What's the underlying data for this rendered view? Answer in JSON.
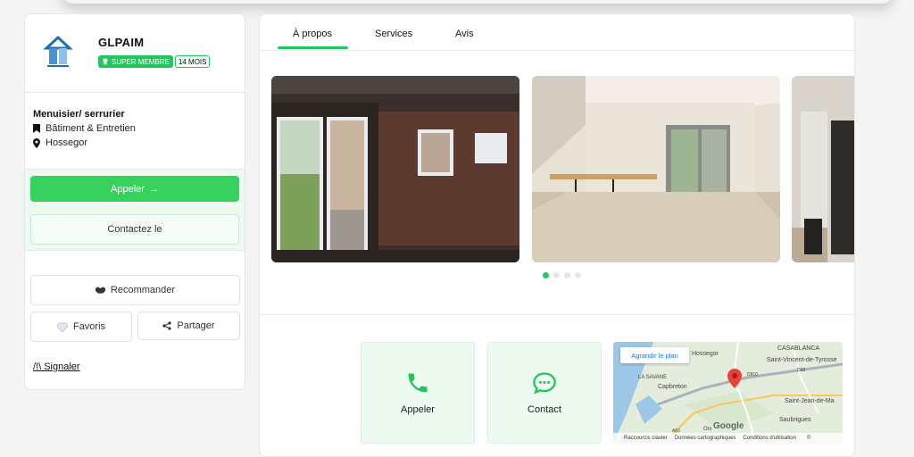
{
  "company": {
    "name": "GLPAIM",
    "badge_super": "SUPER MEMBRE",
    "badge_months": "14 MOIS"
  },
  "profile": {
    "profession": "Menuisier/ serrurier",
    "category": "Bâtiment & Entretien",
    "location": "Hossegor"
  },
  "actions": {
    "call_label": "Appeler",
    "call_arrow": "→",
    "contact_label": "Contactez le",
    "recommend_label": "Recommander",
    "favorites_label": "Favoris",
    "share_label": "Partager",
    "report_label": "/!\\ Signaler"
  },
  "tabs": [
    {
      "label": "À propos",
      "active": true
    },
    {
      "label": "Services",
      "active": false
    },
    {
      "label": "Avis",
      "active": false
    }
  ],
  "gallery": {
    "slide_count": 4,
    "active_index": 0
  },
  "contact_cards": {
    "call_label": "Appeler",
    "contact_label": "Contact"
  },
  "map": {
    "enlarge_label": "Agrandir le plan",
    "places": {
      "hossegor": "Hossegor",
      "casablanca": "CASABLANCA",
      "st_vincent": "Saint-Vincent-de-Tyrosse",
      "la_savane": "LA SAVANE",
      "capbreton": "Capbreton",
      "st_jean": "Saint-Jean-de-Ma",
      "saubrigues": "Saubrigues",
      "road_d810": "D810",
      "road_d33": "D33",
      "road_a63": "A63",
      "town_orx": "Orx"
    },
    "google": "Google",
    "footer": {
      "shortcuts": "Raccourcis clavier",
      "data": "Données cartographiques",
      "terms": "Conditions d'utilisation"
    }
  },
  "colors": {
    "accent": "#22c55e",
    "button_green": "#37d15e",
    "soft_green": "#edfaf0"
  }
}
